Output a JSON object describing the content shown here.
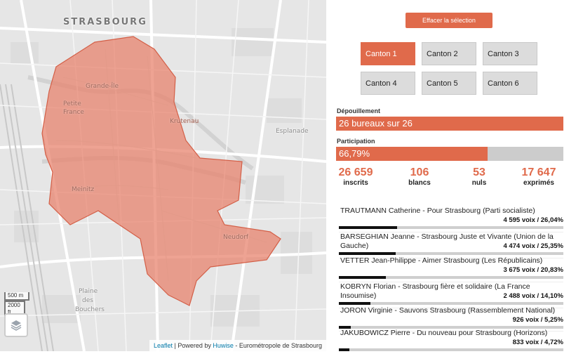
{
  "map": {
    "city_label": "STRASBOURG",
    "district_labels": {
      "grande_ile": "Grande-Île",
      "petite_france_1": "Petite",
      "petite_france_2": "France",
      "krutenau": "Krutenau",
      "esplanade": "Esplanade",
      "neuhof": "Neudorf",
      "meinau_1": "Plaine",
      "meinau_2": "des",
      "meinau_3": "Bouchers",
      "koenigshoffen": "Meinitz"
    },
    "scale": {
      "metric": "500 m",
      "imperial": "2000 ft"
    },
    "attribution": {
      "leaflet": "Leaflet",
      "sep1": " | Powered by ",
      "huwise": "Huwise",
      "rest": " - Eurométropole de Strasbourg"
    },
    "area_color": "#e8806a"
  },
  "panel": {
    "clear_button": "Effacer la sélection",
    "cantons": [
      "Canton 1",
      "Canton 2",
      "Canton 3",
      "Canton 4",
      "Canton 5",
      "Canton 6"
    ],
    "active_canton": 0,
    "depouillement": {
      "label": "Dépouillement",
      "text": "26 bureaux sur 26",
      "fraction": 1.0
    },
    "participation": {
      "label": "Participation",
      "text": "66,79%",
      "fraction": 0.6679
    },
    "stats": [
      {
        "value": "26 659",
        "label": "inscrits"
      },
      {
        "value": "106",
        "label": "blancs"
      },
      {
        "value": "53",
        "label": "nuls"
      },
      {
        "value": "17 647",
        "label": "exprimés"
      }
    ],
    "candidates": [
      {
        "name": "TRAUTMANN Catherine - Pour Strasbourg (Parti socialiste)",
        "votes": "4 595 voix /  26,04%",
        "share": 26.04
      },
      {
        "name": "BARSEGHIAN Jeanne - Strasbourg Juste et Vivante (Union de la Gauche)",
        "votes": "4 474 voix /  25,35%",
        "share": 25.35
      },
      {
        "name": "VETTER Jean-Philippe - Aimer Strasbourg (Les Républicains)",
        "votes": "3 675 voix /  20,83%",
        "share": 20.83
      },
      {
        "name": "KOBRYN Florian - Strasbourg fière et solidaire (La France Insoumise)",
        "votes": "2 488 voix /  14,10%",
        "share": 14.1
      },
      {
        "name": "JORON Virginie - Sauvons Strasbourg (Rassemblement National)",
        "votes": "926 voix /  5,25%",
        "share": 5.25
      },
      {
        "name": "JAKUBOWICZ Pierre - Du nouveau pour Strasbourg (Horizons)",
        "votes": "833 voix /  4,72%",
        "share": 4.72
      }
    ],
    "colors": {
      "accent": "#e06a4b",
      "track": "#cccccc"
    }
  }
}
